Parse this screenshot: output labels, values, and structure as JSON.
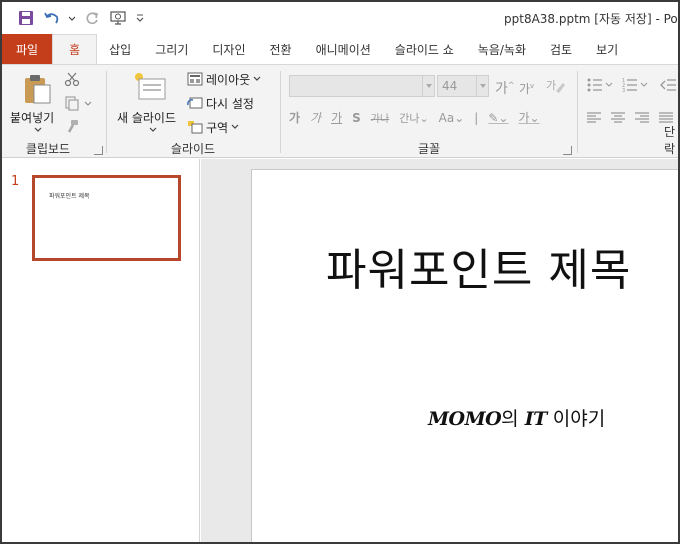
{
  "window": {
    "title": "ppt8A38.pptm [자동 저장]  -  Po"
  },
  "tabs": {
    "file": "파일",
    "home": "홈",
    "insert": "삽입",
    "draw": "그리기",
    "design": "디자인",
    "transitions": "전환",
    "animations": "애니메이션",
    "slideshow": "슬라이드 쇼",
    "record": "녹음/녹화",
    "review": "검토",
    "view": "보기"
  },
  "ribbon": {
    "clipboard": {
      "paste_label": "붙여넣기",
      "group_label": "클립보드"
    },
    "slides": {
      "new_slide_label": "새 슬라이드",
      "layout_label": "레이아웃",
      "reset_label": "다시 설정",
      "section_label": "구역",
      "group_label": "슬라이드"
    },
    "font": {
      "font_name": "",
      "font_size": "44",
      "group_label": "글꼴"
    },
    "paragraph": {
      "group_label": "단락"
    }
  },
  "thumbnails": [
    {
      "number": "1",
      "title": "파워포인트 제목"
    }
  ],
  "slide": {
    "title": "파워포인트 제목",
    "subtitle_part1": "MOMO",
    "subtitle_part2": "의 ",
    "subtitle_part3": "IT",
    "subtitle_part4": " 이야기"
  },
  "colors": {
    "accent": "#c43e1c",
    "thumb_border": "#b7472a",
    "ribbon_bg": "#f3f3f3"
  }
}
